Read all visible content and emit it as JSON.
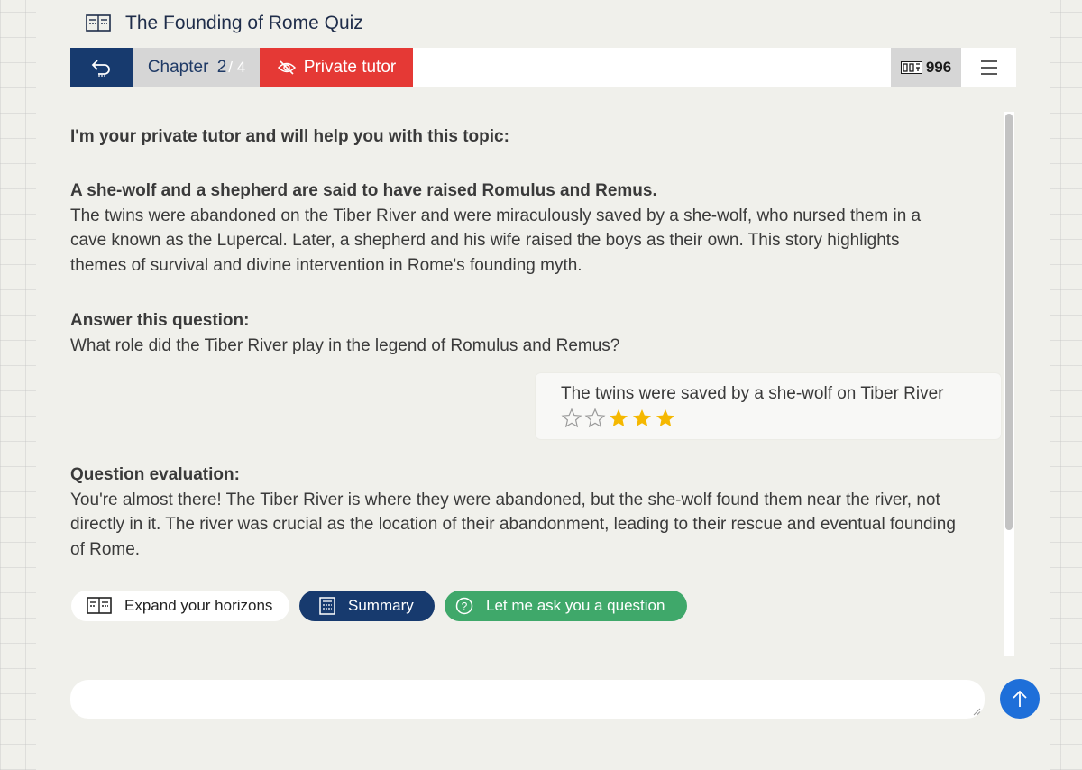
{
  "app": {
    "title": "The Founding of Rome Quiz",
    "title_icon": "open-book-icon"
  },
  "navbar": {
    "back_icon": "return-arrow-icon",
    "chapter_label": "Chapter",
    "chapter_current": "2",
    "chapter_total": "/ 4",
    "tutor_label": "Private tutor",
    "tutor_icon": "eye-slash-icon",
    "points_value": "996",
    "points_icon": "score-counter-icon",
    "menu_icon": "hamburger-menu-icon"
  },
  "tutor": {
    "intro": "I'm your private tutor and will help you with this topic:",
    "fact_title": "A she-wolf and a shepherd are said to have raised Romulus and Remus.",
    "fact_body": "The twins were abandoned on the Tiber River and were miraculously saved by a she-wolf, who nursed them in a cave known as the Lupercal. Later, a shepherd and his wife raised the boys as their own. This story highlights themes of survival and divine intervention in Rome's founding myth.",
    "question_heading": "Answer this question:",
    "question_text": "What role did the Tiber River play in the legend of Romulus and Remus?"
  },
  "user_answer": {
    "text": "The twins were saved by a she-wolf on Tiber River",
    "rating": 3,
    "rating_max": 5,
    "star_filled_color": "#f5b800",
    "star_empty_color": "#9a9a9a"
  },
  "evaluation": {
    "heading": "Question evaluation:",
    "text": "You're almost there! The Tiber River is where they were abandoned, but the she-wolf found them near the river, not directly in it. The river was crucial as the location of their abandonment, leading to their rescue and eventual founding of Rome."
  },
  "actions": {
    "expand_label": "Expand your horizons",
    "expand_icon": "open-book-icon",
    "summary_label": "Summary",
    "summary_icon": "document-list-icon",
    "ask_label": "Let me ask you a question",
    "ask_icon": "question-circle-icon"
  },
  "chat": {
    "placeholder": "",
    "send_icon": "arrow-up-icon"
  },
  "colors": {
    "navy": "#173a6e",
    "red": "#e53935",
    "green": "#3fa86a",
    "send_blue": "#1e6fd9",
    "gray_tab": "#d6d6d6"
  }
}
